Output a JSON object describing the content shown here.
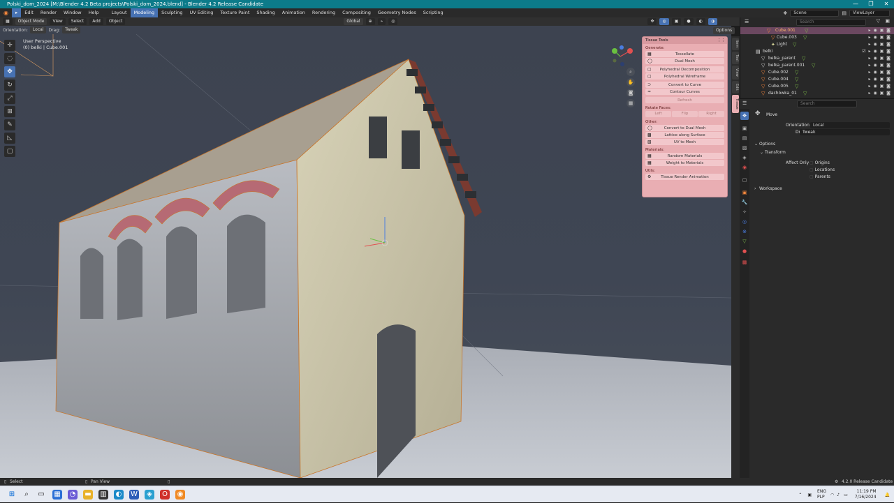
{
  "window": {
    "title": "Polski_dom_2024 [M:\\Blender 4.2 Beta projects\\Polski_dom_2024.blend] - Blender 4.2 Release Candidate",
    "controls": [
      "—",
      "❐",
      "✕"
    ]
  },
  "menu": {
    "items": [
      "Edit",
      "Render",
      "Window",
      "Help"
    ],
    "workspaces": [
      "Layout",
      "Modeling",
      "Sculpting",
      "UV Editing",
      "Texture Paint",
      "Shading",
      "Animation",
      "Rendering",
      "Compositing",
      "Geometry Nodes",
      "Scripting"
    ],
    "active_workspace": "Modeling",
    "scene": "Scene",
    "view_layer": "ViewLayer"
  },
  "header3d": {
    "mode": "Object Mode",
    "menus": [
      "View",
      "Select",
      "Add",
      "Object"
    ],
    "transform_orientation": "Global",
    "options": "Options"
  },
  "tool_settings": {
    "orientation_label": "Orientation:",
    "orientation_value": "Local",
    "drag_label": "Drag:",
    "drag_value": "Tweak"
  },
  "viewport": {
    "hud_line1": "User Perspective",
    "hud_line2": "(0) belki | Cube.001"
  },
  "tissue_panel": {
    "title": "Tissue Tools",
    "generate_label": "Generate:",
    "generate_buttons": [
      "Tessellate",
      "Dual Mesh",
      "Polyhedral Decomposition",
      "Polyhedral Wireframe",
      "Convert to Curve",
      "Contour Curves"
    ],
    "refresh": "Refresh",
    "rotate_label": "Rotate Faces:",
    "rotate_buttons": [
      "Left",
      "Flip",
      "Right"
    ],
    "other_label": "Other:",
    "other_buttons": [
      "Convert to Dual Mesh",
      "Lattice along Surface",
      "UV to Mesh"
    ],
    "materials_label": "Materials:",
    "materials_buttons": [
      "Random Materials",
      "Weight to Materials"
    ],
    "utils_label": "Utils:",
    "utils_buttons": [
      "Tissue Render Animation"
    ]
  },
  "sidebar_tabs": [
    "Item",
    "Tool",
    "View",
    "Edit",
    "Tissue"
  ],
  "outliner": {
    "search_placeholder": "Search",
    "rows": [
      {
        "name": "Cube.001",
        "selected": true
      },
      {
        "name": "Cube.003",
        "selected": false
      },
      {
        "name": "Light",
        "selected": false
      },
      {
        "name": "belki",
        "selected": false
      },
      {
        "name": "belka_parent",
        "selected": false
      },
      {
        "name": "belka_parent.001",
        "selected": false
      },
      {
        "name": "Cube.002",
        "selected": false
      },
      {
        "name": "Cube.004",
        "selected": false
      },
      {
        "name": "Cube.005",
        "selected": false
      },
      {
        "name": "dachówka_01",
        "selected": false
      }
    ]
  },
  "properties": {
    "search_placeholder": "Search",
    "tool_name": "Move",
    "orientation_label": "Orientation",
    "orientation_value": "Local",
    "drag_label": "Drag",
    "drag_value": "Tweak",
    "options_label": "Options",
    "transform_label": "Transform",
    "affect_only_label": "Affect Only",
    "affect_options": [
      "Origins",
      "Locations",
      "Parents"
    ],
    "workspace_label": "Workspace"
  },
  "statusbar": {
    "left": "Select",
    "mid": "Pan View",
    "version": "4.2.0 Release Candidate"
  },
  "taskbar": {
    "lang1": "ENG",
    "lang2": "PLP",
    "time": "11:19 PM",
    "date": "7/16/2024"
  },
  "colors": {
    "accent": "#4772b3",
    "tissue_panel": "#e9aeb3",
    "titlebar": "#0c7b8a",
    "selection": "#ff8a3d"
  }
}
